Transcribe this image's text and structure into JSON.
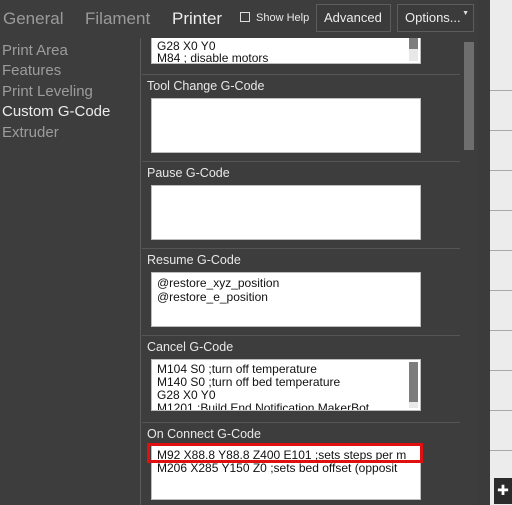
{
  "tabs": [
    {
      "label": "General"
    },
    {
      "label": "Filament"
    },
    {
      "label": "Printer"
    }
  ],
  "show_help": "Show Help",
  "mode_button": "Advanced",
  "options_button": "Options...",
  "options_caret": "▼",
  "sidebar": {
    "items": [
      {
        "label": "Print Area"
      },
      {
        "label": "Features"
      },
      {
        "label": "Print Leveling"
      },
      {
        "label": "Custom G-Code"
      },
      {
        "label": "Extruder"
      }
    ]
  },
  "sections": {
    "top_partial": {
      "lines": [
        "G28 X0 Y0",
        "M84    ; disable motors"
      ]
    },
    "tool_change": {
      "title": "Tool Change G-Code",
      "lines": []
    },
    "pause": {
      "title": "Pause G-Code",
      "lines": []
    },
    "resume": {
      "title": "Resume G-Code",
      "lines": [
        "@restore_xyz_position",
        "@restore_e_position"
      ]
    },
    "cancel": {
      "title": "Cancel G-Code",
      "lines": [
        "M104 S0 ;turn off temperature",
        "M140 S0 ;turn off bed temperature",
        "G28 X0 Y0",
        "M1201 ;Build End Notification MakerBot"
      ]
    },
    "on_connect": {
      "title": "On Connect G-Code",
      "lines": [
        "M92 X88.8 Y88.8 Z400 E101 ;sets steps per m",
        "M206 X285 Y150 Z0 ;sets bed offset (opposit"
      ]
    }
  },
  "corner_icon": "✚"
}
